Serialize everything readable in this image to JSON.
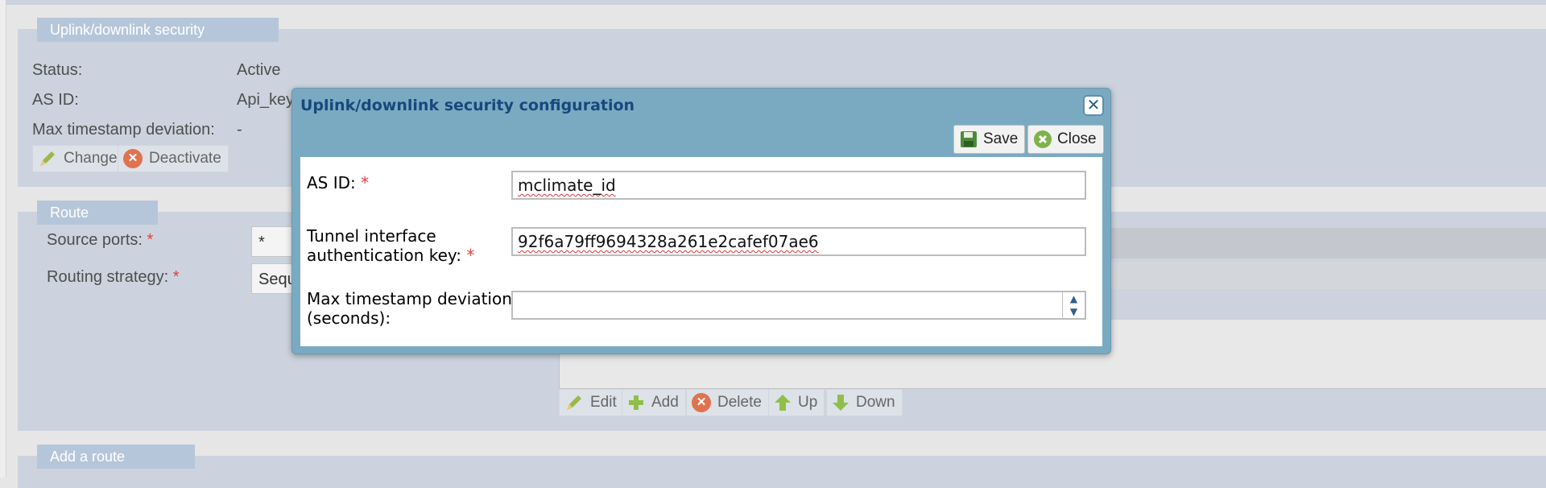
{
  "security_panel": {
    "legend": "Uplink/downlink security",
    "status_label": "Status:",
    "status_value": "Active",
    "as_id_label": "AS ID:",
    "as_id_value": "Api_key",
    "max_ts_label": "Max timestamp deviation:",
    "max_ts_value": "-",
    "change_label": "Change",
    "deactivate_label": "Deactivate"
  },
  "route_panel": {
    "legend": "Route",
    "source_ports_label": "Source ports:",
    "source_ports_value": "*",
    "routing_strategy_label": "Routing strategy:",
    "routing_strategy_value": "Sequ",
    "required_mark": "*",
    "buttons": {
      "edit": "Edit",
      "add": "Add",
      "delete": "Delete",
      "up": "Up",
      "down": "Down"
    }
  },
  "add_route_panel": {
    "legend": "Add a route"
  },
  "dialog": {
    "title": "Uplink/downlink security configuration",
    "close_x": "✕",
    "save_label": "Save",
    "close_label": "Close",
    "required_mark": "*",
    "as_id_label": "AS ID:",
    "as_id_value": "mclimate_id",
    "tunnel_key_label_line1": "Tunnel interface",
    "tunnel_key_label_line2": "authentication key:",
    "tunnel_key_value": "92f6a79ff9694328a261e2cafef07ae6",
    "max_ts_label_line1": "Max timestamp deviation",
    "max_ts_label_line2": "(seconds):",
    "max_ts_value": ""
  },
  "colors": {
    "panel_bg": "#ccd3de",
    "legend_bg": "#b6c6da",
    "dialog_header": "#7aaac2",
    "dialog_title": "#17487d",
    "required": "#e0413c"
  },
  "icons": [
    "pencil-icon",
    "deactivate-icon",
    "plus-icon",
    "arrow-up-icon",
    "arrow-down-icon",
    "save-icon",
    "close-circle-icon",
    "close-x-icon",
    "spinner-icon"
  ]
}
